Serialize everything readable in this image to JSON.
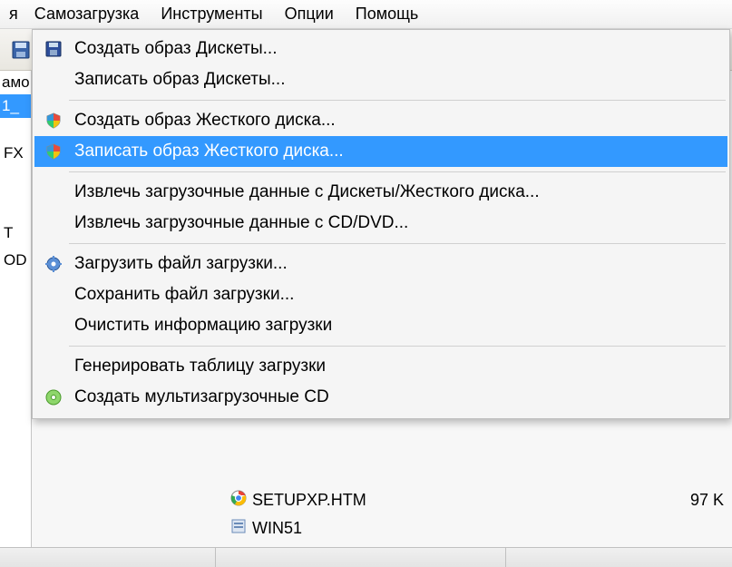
{
  "menubar": {
    "items": [
      {
        "label": "я"
      },
      {
        "label": "Самозагрузка"
      },
      {
        "label": "Инструменты"
      },
      {
        "label": "Опции"
      },
      {
        "label": "Помощь"
      }
    ]
  },
  "tree": {
    "rows": [
      {
        "label": "амо",
        "selected": false
      },
      {
        "label": "1_",
        "selected": true
      }
    ]
  },
  "left_fragments": [
    "FX",
    "T",
    "OD"
  ],
  "dropdown": {
    "items": [
      {
        "icon": "floppy-icon",
        "label": "Создать образ Дискеты..."
      },
      {
        "icon": null,
        "label": "Записать образ Дискеты..."
      },
      {
        "sep": true
      },
      {
        "icon": "shield-icon",
        "label": "Создать образ Жесткого диска..."
      },
      {
        "icon": "shield-icon",
        "label": "Записать образ Жесткого диска...",
        "highlight": true
      },
      {
        "sep": true
      },
      {
        "icon": null,
        "label": "Извлечь загрузочные данные с Дискеты/Жесткого диска..."
      },
      {
        "icon": null,
        "label": "Извлечь загрузочные данные с CD/DVD..."
      },
      {
        "sep": true
      },
      {
        "icon": "gear-icon",
        "label": "Загрузить файл загрузки..."
      },
      {
        "icon": null,
        "label": "Сохранить файл загрузки..."
      },
      {
        "icon": null,
        "label": "Очистить информацию загрузки"
      },
      {
        "sep": true
      },
      {
        "icon": null,
        "label": "Генерировать таблицу загрузки"
      },
      {
        "icon": "disc-green-icon",
        "label": "Создать мультизагрузочные CD"
      }
    ]
  },
  "files": {
    "rows": [
      {
        "icon": "chrome-icon",
        "name": "SETUPXP.HTM",
        "size": "97 K"
      },
      {
        "icon": "sys-icon",
        "name": "WIN51",
        "size": ""
      }
    ]
  }
}
